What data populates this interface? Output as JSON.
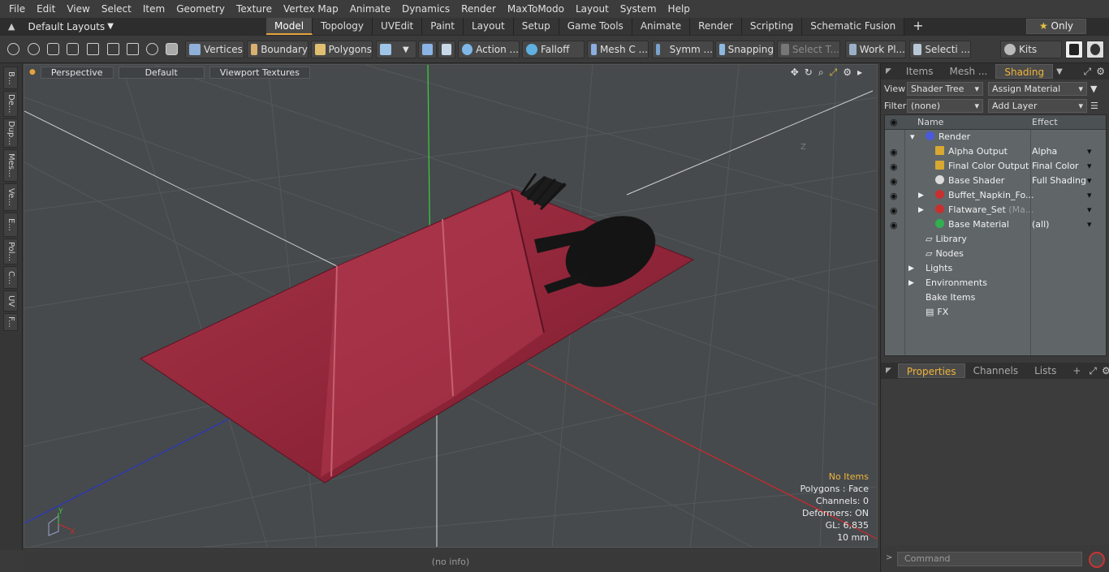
{
  "menu": [
    "File",
    "Edit",
    "View",
    "Select",
    "Item",
    "Geometry",
    "Texture",
    "Vertex Map",
    "Animate",
    "Dynamics",
    "Render",
    "MaxToModo",
    "Layout",
    "System",
    "Help"
  ],
  "layout": {
    "selector": "Default Layouts",
    "tabs": [
      "Model",
      "Topology",
      "UVEdit",
      "Paint",
      "Layout",
      "Setup",
      "Game Tools",
      "Animate",
      "Render",
      "Scripting",
      "Schematic Fusion"
    ],
    "active_tab": "Model",
    "plus": "+",
    "only_label": "Only"
  },
  "toolbar": {
    "vertices": "Vertices",
    "boundary": "Boundary",
    "polygons": "Polygons",
    "action": "Action ...",
    "falloff": "Falloff",
    "mesh": "Mesh C ...",
    "symm": "Symm ...",
    "snapping": "Snapping",
    "select_t": "Select T...",
    "work_pl": "Work Pl...",
    "selecti": "Selecti ...",
    "kits": "Kits"
  },
  "left_tabs": [
    "B...",
    "De...",
    "Dup...",
    "Mes...",
    "Ve...",
    "E...",
    "Pol...",
    "C...",
    "UV",
    "F..."
  ],
  "viewport": {
    "perspective": "Perspective",
    "default": "Default",
    "textures": "Viewport Textures",
    "info": {
      "no_items": "No Items",
      "polygons": "Polygons : Face",
      "channels": "Channels: 0",
      "deformers": "Deformers: ON",
      "gl": "GL: 6,835",
      "scale": "10 mm"
    },
    "axis_y": "Y",
    "axis_x": "X",
    "axis_z": "Z"
  },
  "status": "(no info)",
  "right": {
    "tabs": [
      "Items",
      "Mesh ...",
      "Shading"
    ],
    "active": "Shading",
    "view_label": "View",
    "view_value": "Shader Tree",
    "assign": "Assign Material",
    "filter_label": "Filter",
    "filter_value": "(none)",
    "add_layer": "Add Layer",
    "col_name": "Name",
    "col_effect": "Effect",
    "rows": [
      {
        "name": "Render",
        "effect": "",
        "color": "#4a5ad8"
      },
      {
        "name": "Alpha Output",
        "effect": "Alpha",
        "color": "#d8a830"
      },
      {
        "name": "Final Color Output",
        "effect": "Final Color",
        "color": "#d8a830"
      },
      {
        "name": "Base Shader",
        "effect": "Full Shading",
        "color": "#dcdcdc"
      },
      {
        "name": "Buffet_Napkin_Fo...",
        "effect": "",
        "color": "#c83030"
      },
      {
        "name": "Flatware_Set",
        "suffix": "(Ma...",
        "effect": "",
        "color": "#c83030"
      },
      {
        "name": "Base Material",
        "effect": "(all)",
        "color": "#30b050"
      },
      {
        "name": "Library",
        "effect": ""
      },
      {
        "name": "Nodes",
        "effect": ""
      },
      {
        "name": "Lights",
        "effect": ""
      },
      {
        "name": "Environments",
        "effect": ""
      },
      {
        "name": "Bake Items",
        "effect": ""
      },
      {
        "name": "FX",
        "effect": ""
      }
    ],
    "ptabs": [
      "Properties",
      "Channels",
      "Lists",
      "+"
    ],
    "command_placeholder": "Command"
  }
}
